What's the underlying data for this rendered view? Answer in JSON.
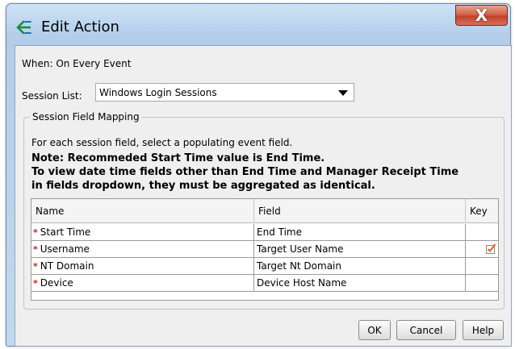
{
  "window": {
    "title": "Edit Action",
    "close_label": "X"
  },
  "when_text": "When: On Every Event",
  "session_list": {
    "label": "Session List:",
    "value": "Windows Login Sessions"
  },
  "mapping": {
    "legend": "Session Field Mapping",
    "help": "For each session field, select a populating event field.",
    "note_lines": [
      "Note: Recommeded Start Time value is End Time.",
      "To view date time fields other than End Time and Manager Receipt Time",
      "in fields dropdown, they must be aggregated as identical."
    ],
    "columns": [
      "Name",
      "Field",
      "Key"
    ],
    "rows": [
      {
        "required": "*",
        "name": "Start Time",
        "field": "End Time",
        "key": false
      },
      {
        "required": "*",
        "name": "Username",
        "field": "Target User Name",
        "key": true
      },
      {
        "required": "*",
        "name": "NT Domain",
        "field": "Target Nt Domain",
        "key": false
      },
      {
        "required": "*",
        "name": "Device",
        "field": "Device Host Name",
        "key": false
      }
    ]
  },
  "buttons": {
    "ok": "OK",
    "cancel": "Cancel",
    "help": "Help"
  },
  "colors": {
    "required_marker": "#d01818",
    "checkbox_check": "#e8621a"
  }
}
